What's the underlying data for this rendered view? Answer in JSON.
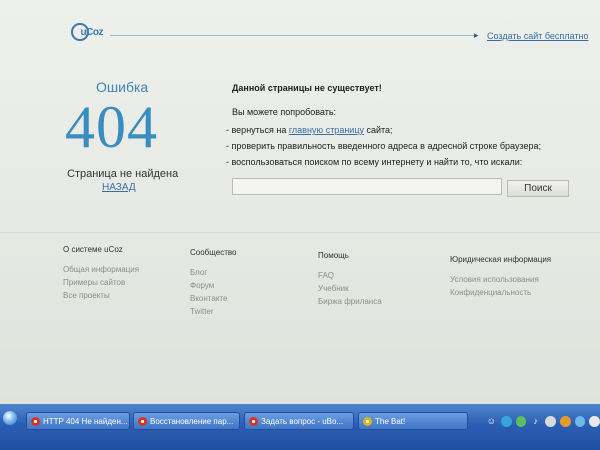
{
  "header": {
    "logo_text": "uCoz",
    "create_link": "Создать сайт бесплатно"
  },
  "error": {
    "title": "Ошибка",
    "code": "404",
    "subtitle": "Страница не найдена",
    "back_link": "НАЗАД"
  },
  "info": {
    "heading": "Данной страницы не существует!",
    "try_label": "Вы можете попробовать:",
    "item1_pre": "- вернуться на",
    "item1_link": "главную страницу",
    "item1_post": "сайта;",
    "item2": "- проверить правильность введенного адреса в адресной строке браузера;",
    "item3": "- воспользоваться поиском по всему интернету и найти то, что искали:"
  },
  "search": {
    "value": "",
    "button": "Поиск"
  },
  "footer": {
    "col1": {
      "heading": "О системе uCoz",
      "links": [
        "Общая информация",
        "Примеры сайтов",
        "Все проекты"
      ]
    },
    "col2": {
      "heading": "Сообщество",
      "links": [
        "Блог",
        "Форум",
        "Вконтакте",
        "Twitter"
      ]
    },
    "col3": {
      "heading": "Помощь",
      "links": [
        "FAQ",
        "Учебник",
        "Биржа фриланса"
      ]
    },
    "col4": {
      "heading": "Юридическая информация",
      "links": [
        "Условия использования",
        "Конфиденциальность"
      ]
    }
  },
  "taskbar": {
    "tasks": [
      "HTTP 404 Не найден...",
      "Восстановление пар...",
      "Задать вопрос - uBo...",
      "The Bat!"
    ]
  }
}
